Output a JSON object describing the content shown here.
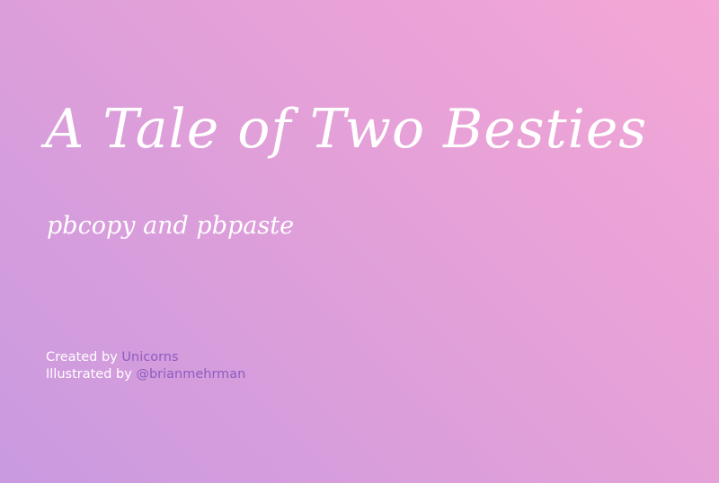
{
  "slide": {
    "title": "A Tale of Two Besties",
    "subtitle": "pbcopy and pbpaste",
    "credits": {
      "created_prefix": "Created by ",
      "created_name": "Unicorns",
      "illustrated_prefix": "Illustrated by ",
      "illustrated_name": "@brianmehrman"
    }
  },
  "colors": {
    "background_gradient": [
      "#f4a7d6",
      "#e3a0d8",
      "#c99ae0"
    ],
    "text": "#ffffff",
    "link": "#8e5cc0"
  }
}
